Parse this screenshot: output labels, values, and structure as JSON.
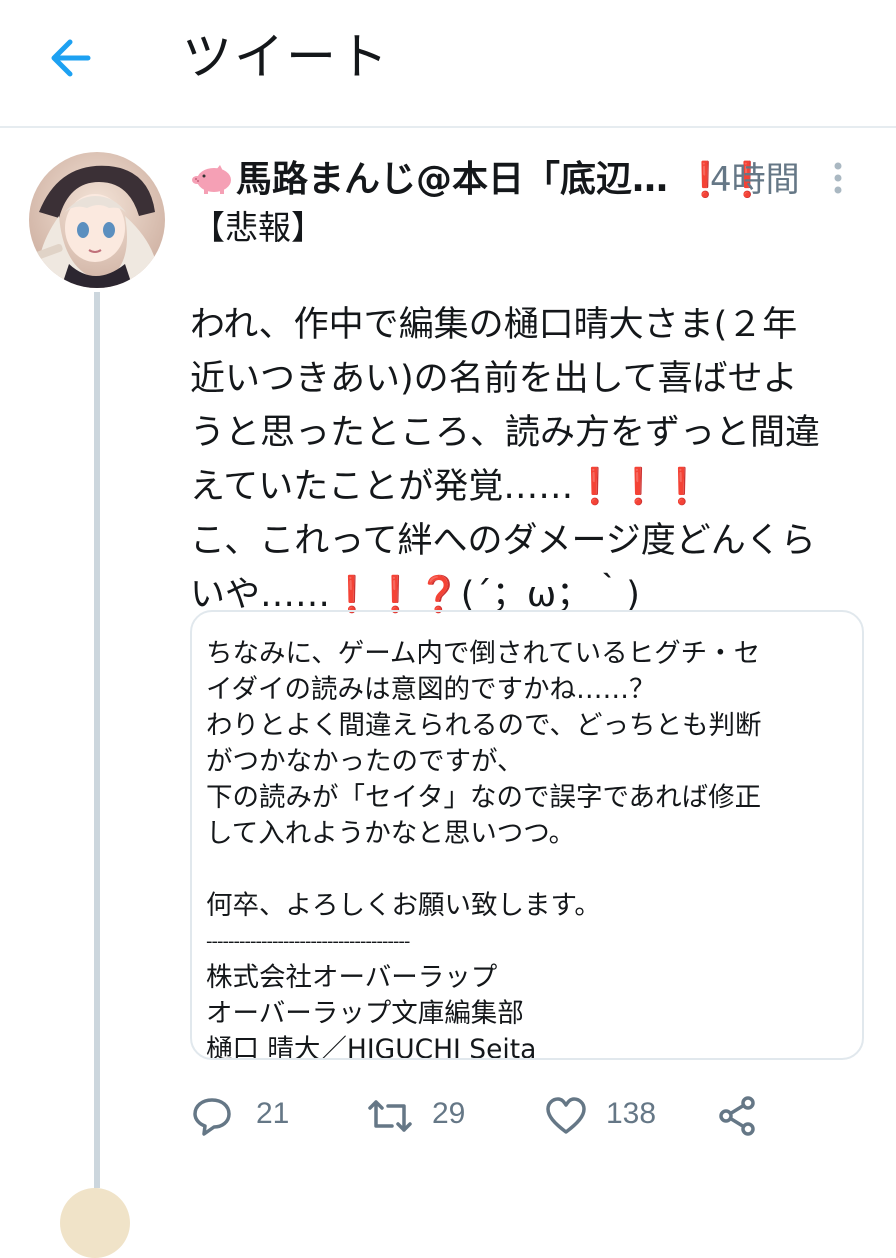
{
  "header": {
    "title": "ツイート",
    "back_icon": "arrow-left-icon",
    "accent_color": "#1da1f2"
  },
  "tweet": {
    "display_name": "馬路まんじ@本日「底辺…",
    "name_suffix": "❗❗",
    "timestamp": "4時間",
    "label": "【悲報】",
    "body_lines": [
      "われ、作中で編集の樋口晴大さま(２年",
      "近いつきあい)の名前を出して喜ばせよ",
      "うと思ったところ、読み方をずっと間違",
      "えていたことが発覚……",
      "こ、これって絆へのダメージ度どんくら",
      "いや……"
    ],
    "body_emoji_line4": "❗❗❗",
    "body_emoji_line6": "❗❗❓",
    "body_tail_line6": "(´；ω；｀)"
  },
  "quote": {
    "lines": [
      "ちなみに、ゲーム内で倒されているヒグチ・セ",
      "イダイの読みは意図的ですかね……？",
      "わりとよく間違えられるので、どっちとも判断",
      "がつかなかったのですが、",
      "下の読みが「セイタ」なので誤字であれば修正",
      "して入れようかなと思いつつ。",
      "",
      "何卒、よろしくお願い致します。",
      "-------------------------------------",
      "株式会社オーバーラップ",
      "オーバーラップ文庫編集部",
      "樋口 晴大／HIGUCHI Seita"
    ]
  },
  "actions": {
    "reply_count": "21",
    "retweet_count": "29",
    "like_count": "138",
    "icons": [
      "reply-icon",
      "retweet-icon",
      "like-icon",
      "share-icon"
    ]
  },
  "colors": {
    "text_primary": "#14171a",
    "text_secondary": "#657786",
    "divider": "#e6ecf0",
    "thread_line": "#ccd6dd",
    "emoji_red": "#d0021b",
    "emoji_pink": "#f5a0b5"
  }
}
